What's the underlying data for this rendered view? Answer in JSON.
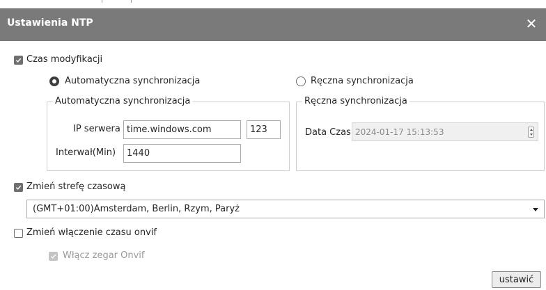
{
  "window": {
    "title": "Ustawienia NTP",
    "close_glyph": "✕"
  },
  "time_modification": {
    "label": "Czas modyfikacji",
    "checked": true,
    "mode_auto_label": "Automatyczna synchronizacja",
    "mode_manual_label": "Ręczna synchronizacja",
    "selected_mode": "auto"
  },
  "auto_group": {
    "legend": "Automatyczna synchronizacja",
    "server_ip_label": "IP serwera",
    "server_ip_value": "time.windows.com",
    "port_value": "123",
    "interval_label": "Interwał(Min)",
    "interval_value": "1440"
  },
  "manual_group": {
    "legend": "Ręczna synchronizacja",
    "datetime_label": "Data Czas",
    "datetime_value": "2024-01-17 15:13:53"
  },
  "timezone": {
    "label": "Zmień strefę czasową",
    "checked": true,
    "selected": "(GMT+01:00)Amsterdam, Berlin, Rzym, Paryż"
  },
  "onvif": {
    "label": "Zmień włączenie czasu onvif",
    "checked": false,
    "clock_label": "Włącz zegar Onvif",
    "clock_checked": true,
    "clock_disabled": true
  },
  "actions": {
    "apply_label": "ustawić"
  },
  "icons": {
    "close": "close-icon",
    "check": "checkmark-icon",
    "spin": "spinner-arrows-icon",
    "dropdown": "chevron-down-icon"
  },
  "colors": {
    "titlebar": "#7a7a7a",
    "checkbox": "#6f6f6f",
    "border": "#cfcfcf",
    "button_bg": "#ececec"
  }
}
